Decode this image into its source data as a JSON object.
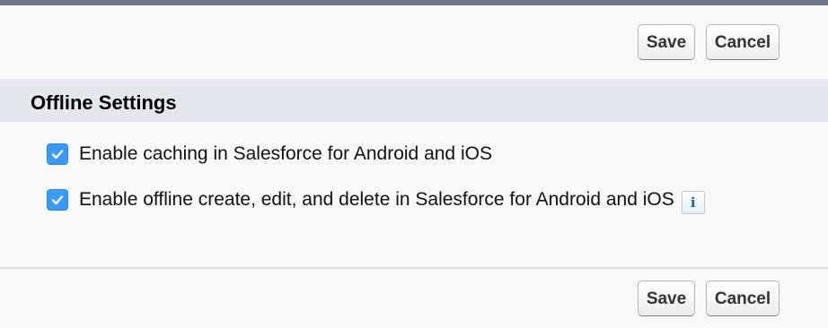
{
  "top_buttons": {
    "save_label": "Save",
    "cancel_label": "Cancel"
  },
  "section": {
    "title": "Offline Settings"
  },
  "options": [
    {
      "label": "Enable caching in Salesforce for Android and iOS",
      "checked": true
    },
    {
      "label": "Enable offline create, edit, and delete in Salesforce for Android and iOS",
      "checked": true,
      "info_icon": "info-icon"
    }
  ],
  "bottom_buttons": {
    "save_label": "Save",
    "cancel_label": "Cancel"
  },
  "colors": {
    "checkbox_accent": "#3b99fc",
    "section_header_bg": "#e4e7ee",
    "top_border": "#6e7586"
  }
}
